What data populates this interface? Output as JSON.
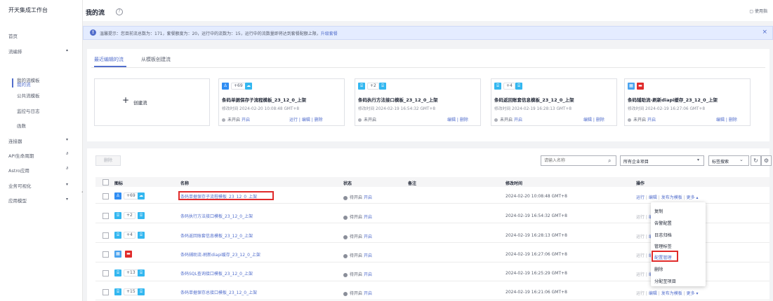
{
  "sidebar": {
    "title": "开天集成工作台",
    "items": [
      {
        "label": "首页"
      },
      {
        "label": "流编排"
      },
      {
        "label": "我的流"
      },
      {
        "label": "我的流模板"
      },
      {
        "label": "公共流模板"
      },
      {
        "label": "监控与日志"
      },
      {
        "label": "函数"
      },
      {
        "label": "连接器"
      },
      {
        "label": "API生命周期"
      },
      {
        "label": "Astro应用"
      },
      {
        "label": "业务可视化"
      },
      {
        "label": "应用模型"
      }
    ]
  },
  "header": {
    "title": "我的流",
    "help_icon": "?",
    "guide_label": "使用指"
  },
  "notice": {
    "text": "温馨提示：您目前流总数为：171，套餐额度为：20，运行中的流数为：15，运行中的流数量即将达到套餐配额上限，",
    "link": "升级套餐",
    "close": "×"
  },
  "recent": {
    "tabs": [
      "最近编辑的流",
      "从模板创建流"
    ],
    "create_plus": "+",
    "create_label": "创建流",
    "cards": [
      {
        "count": "+69",
        "title": "条码单据保存子流程模板_23_12_0_上架",
        "time": "修改时间  2024-02-20 10:08:48 GMT+8",
        "status": "未开启",
        "enable": "开启",
        "ops": "运行 | 编辑 | 删除"
      },
      {
        "count": "+2",
        "title": "条码执行方法接口模板_23_12_0_上架",
        "time": "修改时间  2024-02-19 16:54:32 GMT+8",
        "status": "未开启",
        "enable": "开启",
        "ops": "编辑 | 删除"
      },
      {
        "count": "+4",
        "title": "条码返回账套信息模板_23_12_0_上架",
        "time": "修改时间  2024-02-19 16:28:13 GMT+8",
        "status": "未开启",
        "enable": "开启",
        "ops": "编辑 | 删除"
      },
      {
        "count": "",
        "title": "条码辅助流-刷新diapi缓存_23_12_0_上架",
        "time": "修改时间  2024-02-19 16:27:06 GMT+8",
        "status": "未开启",
        "enable": "开启",
        "ops": "编辑 | 删除"
      }
    ]
  },
  "toolbar": {
    "delete_label": "删除",
    "search_placeholder": "请输入名称",
    "project_select": "所有企业项目",
    "tag_search": "标签搜索"
  },
  "table": {
    "headers": [
      "图标",
      "名称",
      "状态",
      "备注",
      "修改时间",
      "操作"
    ],
    "rows": [
      {
        "count": "+69",
        "name": "条码单据保存子流程模板_23_12_0_上架",
        "status": "待开启",
        "enable": "开启",
        "time": "2024-02-20 10:08:48 GMT+8",
        "run": "运行",
        "edit": "编辑",
        "publish": "发布为模板",
        "more": "更多 ▴"
      },
      {
        "count": "+2",
        "name": "条码执行方法接口模板_23_12_0_上架",
        "status": "待开启",
        "enable": "开启",
        "time": "2024-02-19 16:54:32 GMT+8",
        "run": "运行",
        "edit": "编辑",
        "publish": "",
        "more": ""
      },
      {
        "count": "+4",
        "name": "条码返回账套信息模板_23_12_0_上架",
        "status": "待开启",
        "enable": "开启",
        "time": "2024-02-19 16:28:13 GMT+8",
        "run": "运行",
        "edit": "编辑",
        "publish": "",
        "more": ""
      },
      {
        "count": "",
        "name": "条码辅助流-刷新diapi缓存_23_12_0_上架",
        "status": "待开启",
        "enable": "开启",
        "time": "2024-02-19 16:27:06 GMT+8",
        "run": "运行",
        "edit": "编辑",
        "publish": "",
        "more": ""
      },
      {
        "count": "+13",
        "name": "条码SQL查询接口模板_23_12_0_上架",
        "status": "待开启",
        "enable": "开启",
        "time": "2024-02-19 16:25:29 GMT+8",
        "run": "运行",
        "edit": "编辑",
        "publish": "",
        "more": ""
      },
      {
        "count": "+15",
        "name": "条码单据保存总接口模板_23_12_0_上架",
        "status": "待开启",
        "enable": "开启",
        "time": "2024-02-19 16:21:06 GMT+8",
        "run": "运行",
        "edit": "编辑",
        "publish": "发布为模板",
        "more": "更多 ▾"
      }
    ]
  },
  "more_menu": {
    "items": [
      "复制",
      "告警配置",
      "日志归档",
      "管理标签",
      "配置管理",
      "删除",
      "分配至项目"
    ]
  },
  "colors": {
    "accent": "#526ecc",
    "highlight": "#e02b2b"
  },
  "icons": [
    "help-icon",
    "info-icon",
    "close-icon",
    "plus-icon",
    "search-icon",
    "chevron-down-icon",
    "refresh-icon",
    "gear-icon",
    "flow-app-icon",
    "link-icon"
  ]
}
